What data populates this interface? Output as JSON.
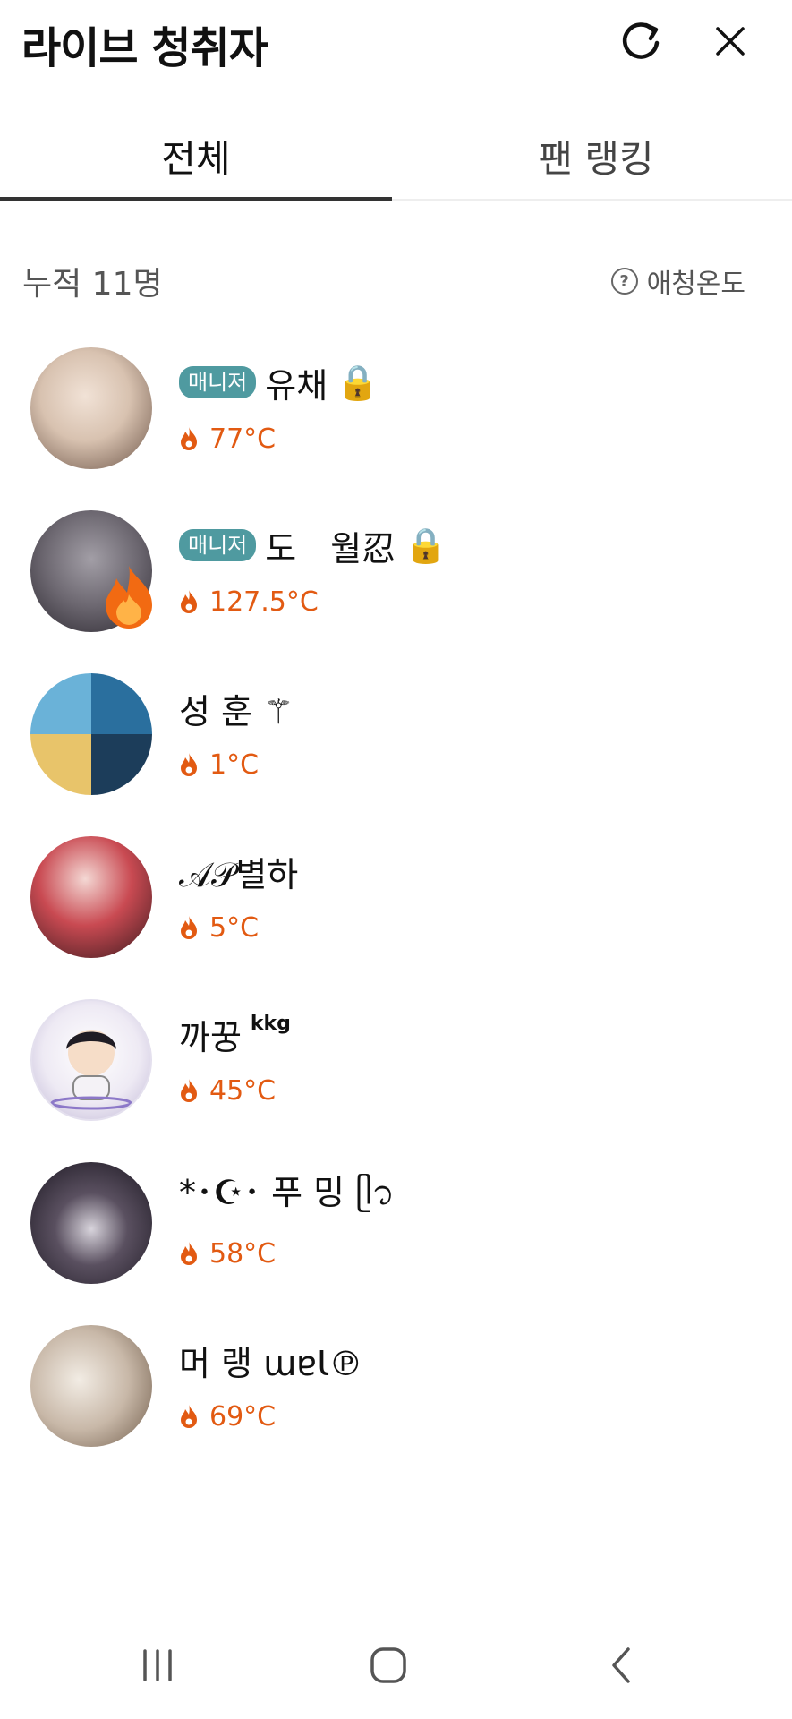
{
  "header": {
    "title": "라이브 청취자",
    "refresh_icon": "refresh-icon",
    "close_icon": "close-icon"
  },
  "tabs": [
    {
      "label": "전체",
      "active": true
    },
    {
      "label": "팬 랭킹",
      "active": false
    }
  ],
  "summary": {
    "count_label": "누적 11명",
    "help_label": "애청온도"
  },
  "listeners": [
    {
      "badge": "매니저",
      "name": "유채",
      "name_suffix": "🔒",
      "temperature": "77°C",
      "avatar_color": "#d8c2b0"
    },
    {
      "badge": "매니저",
      "name": "도　월忍",
      "name_suffix": "🔒",
      "temperature": "127.5°C",
      "avatar_color": "#6c6770",
      "fire_badge": true
    },
    {
      "badge": "",
      "name": "성 훈 ⚚",
      "name_suffix": "",
      "temperature": "1°C",
      "avatar_color": "#3a7ea8"
    },
    {
      "badge": "",
      "name": "𝒜𝒫별하",
      "name_suffix": "",
      "temperature": "5°C",
      "avatar_color": "#c94a52"
    },
    {
      "badge": "",
      "name": "까꿍",
      "name_suffix": "kkg",
      "temperature": "45°C",
      "avatar_color": "#eeeaf4"
    },
    {
      "badge": "",
      "name": "*･☪︎･ 푸 밍 ᥫ᭡",
      "name_suffix": "",
      "temperature": "58°C",
      "avatar_color": "#2a2530"
    },
    {
      "badge": "",
      "name": "머 랭 ɯɐꙆ℗",
      "name_suffix": "",
      "temperature": "69°C",
      "avatar_color": "#c8b8a8"
    }
  ],
  "colors": {
    "accent_temp": "#e25a12",
    "manager_badge": "#4f9aa0",
    "tab_active_underline": "#333333"
  },
  "navbar": {
    "recents_icon": "recents-icon",
    "home_icon": "home-icon",
    "back_icon": "back-icon"
  }
}
